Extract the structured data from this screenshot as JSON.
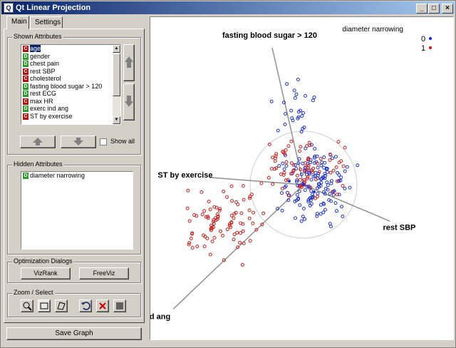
{
  "window": {
    "title": "Qt Linear Projection",
    "minimize": "_",
    "maximize": "□",
    "close": "×"
  },
  "tabs": [
    {
      "label": "Main"
    },
    {
      "label": "Settings"
    }
  ],
  "shown_attributes": {
    "title": "Shown Attributes",
    "items": [
      {
        "type": "C",
        "label": "age"
      },
      {
        "type": "D",
        "label": "gender"
      },
      {
        "type": "D",
        "label": "chest pain"
      },
      {
        "type": "C",
        "label": "rest SBP"
      },
      {
        "type": "C",
        "label": "cholesterol"
      },
      {
        "type": "D",
        "label": "fasting blood sugar > 120"
      },
      {
        "type": "D",
        "label": "rest ECG"
      },
      {
        "type": "C",
        "label": "max HR"
      },
      {
        "type": "D",
        "label": "exerc ind ang"
      },
      {
        "type": "C",
        "label": "ST by exercise"
      }
    ],
    "show_all": "Show all"
  },
  "hidden_attributes": {
    "title": "Hidden Attributes",
    "items": [
      {
        "type": "D",
        "label": "diameter narrowing"
      }
    ]
  },
  "optimization": {
    "title": "Optimization Dialogs",
    "vizrank": "VizRank",
    "freeviz": "FreeViz"
  },
  "zoom": {
    "title": "Zoom / Select"
  },
  "save_graph": "Save Graph",
  "colors": {
    "red": "#cc2222",
    "blue": "#2233cc",
    "axis": "#909090"
  },
  "legend": {
    "title": "diameter narrowing",
    "classes": [
      "0",
      "1"
    ]
  },
  "anchors": [
    {
      "label": "fasting blood sugar > 120",
      "x": -0.22,
      "y": 0.96
    },
    {
      "label": "ST by exercise",
      "x": -0.78,
      "y": 0.06
    },
    {
      "label": "rest SBP",
      "x": 0.9,
      "y": -0.38
    },
    {
      "label": "exerc ind ang",
      "x": -0.87,
      "y": -0.83
    }
  ]
}
